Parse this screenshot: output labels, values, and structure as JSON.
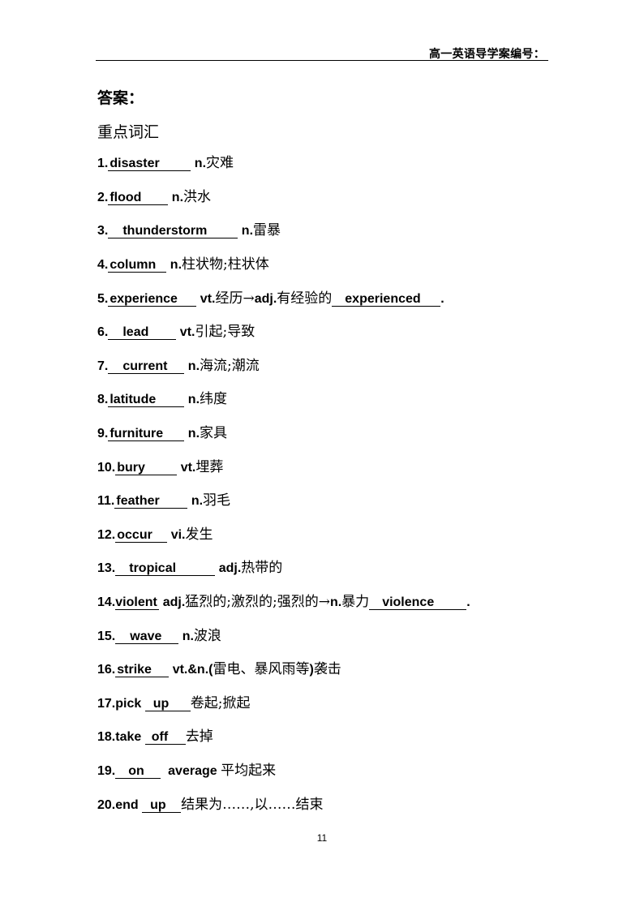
{
  "header": {
    "title": "高一英语导学案编号："
  },
  "answers_heading": "答案：",
  "vocab_heading": "重点词汇",
  "items": [
    {
      "num": "1.",
      "answer": "disaster",
      "meaning_pos": "n.",
      "meaning_cn": "灾难"
    },
    {
      "num": "2.",
      "answer": "flood",
      "meaning_pos": "n.",
      "meaning_cn": "洪水"
    },
    {
      "num": "3.",
      "answer": "thunderstorm",
      "meaning_pos": "n.",
      "meaning_cn": "雷暴"
    },
    {
      "num": "4.",
      "answer": "column",
      "meaning_pos": "n.",
      "meaning_cn": "柱状物;柱状体"
    },
    {
      "num": "5.",
      "answer": "experience",
      "meaning_pos": "vt.",
      "meaning_cn": "经历→",
      "extra_pos": "adj.",
      "extra_cn": "有经验的",
      "extra_answer": "experienced",
      "end": "."
    },
    {
      "num": "6.",
      "answer": "lead",
      "meaning_pos": "vt.",
      "meaning_cn": "引起;导致"
    },
    {
      "num": "7.",
      "answer": "current",
      "meaning_pos": "n.",
      "meaning_cn": "海流;潮流"
    },
    {
      "num": "8.",
      "answer": "latitude",
      "meaning_pos": "n.",
      "meaning_cn": "纬度"
    },
    {
      "num": "9.",
      "answer": "furniture",
      "meaning_pos": "n.",
      "meaning_cn": "家具"
    },
    {
      "num": "10.",
      "answer": "bury",
      "meaning_pos": "vt.",
      "meaning_cn": "埋葬"
    },
    {
      "num": "11.",
      "answer": "feather",
      "meaning_pos": "n.",
      "meaning_cn": "羽毛"
    },
    {
      "num": "12.",
      "answer": "occur",
      "meaning_pos": "vi.",
      "meaning_cn": "发生"
    },
    {
      "num": "13.",
      "answer": "tropical",
      "meaning_pos": "adj.",
      "meaning_cn": "热带的"
    },
    {
      "num": "14.",
      "answer": "violent",
      "meaning_pos": "adj.",
      "meaning_cn": "猛烈的;激烈的;强烈的→",
      "extra_pos": "n.",
      "extra_cn": "暴力",
      "extra_answer": "violence",
      "end": "."
    },
    {
      "num": "15.",
      "answer": "wave",
      "meaning_pos": "n.",
      "meaning_cn": "波浪"
    },
    {
      "num": "16.",
      "answer": "strike",
      "meaning_pos": "vt.&n.(",
      "meaning_cn": "雷电、暴风雨等",
      "meaning_tail": ")",
      "meaning_cn2": "袭击"
    },
    {
      "num": "17.",
      "prefix": "pick",
      "answer": "up",
      "meaning_cn": "卷起;掀起"
    },
    {
      "num": "18.",
      "prefix": "take",
      "answer": "off",
      "meaning_cn": "去掉"
    },
    {
      "num": "19.",
      "answer": "on",
      "suffix": "average",
      "meaning_cn": "平均起来"
    },
    {
      "num": "20.",
      "prefix": "end",
      "answer": "up",
      "meaning_cn": "结果为……,以……结束"
    }
  ],
  "page_number": "11"
}
